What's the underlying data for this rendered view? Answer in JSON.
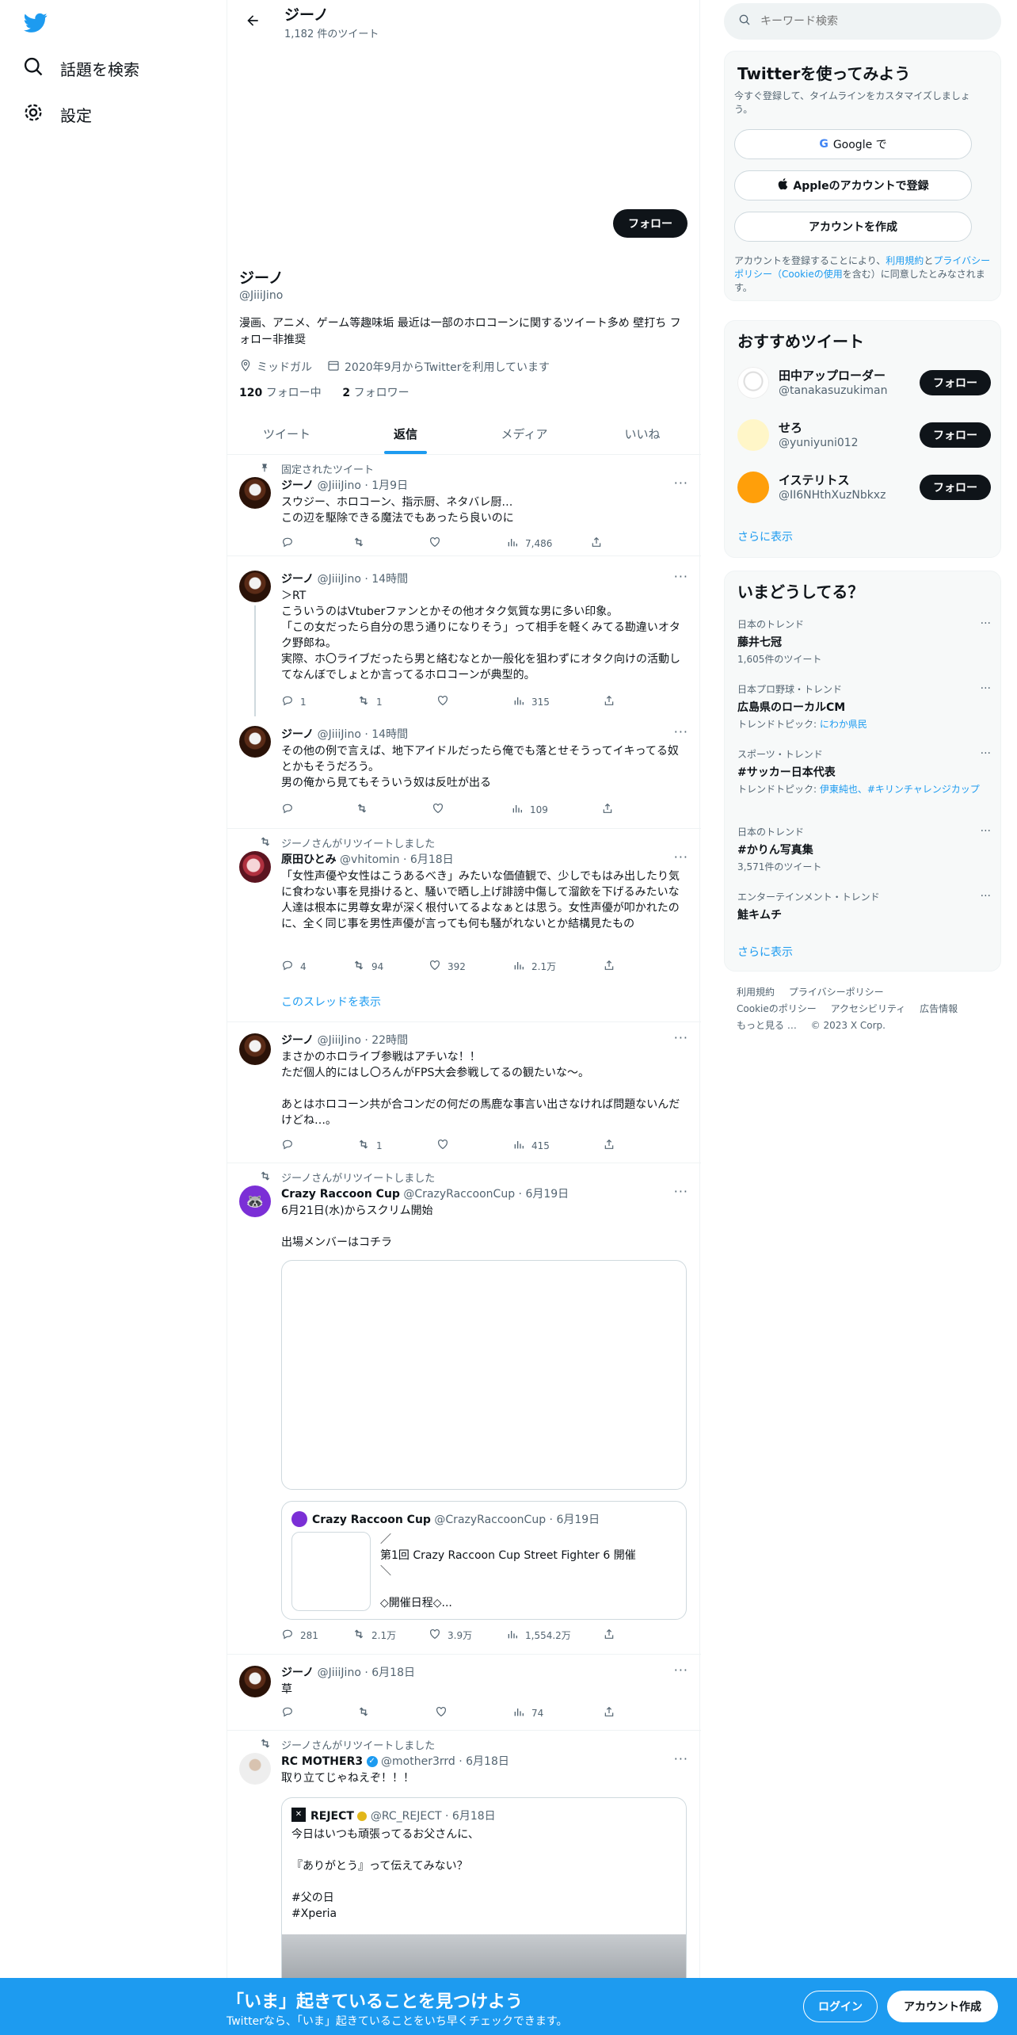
{
  "nav": {
    "explore_label": "話題を検索",
    "settings_label": "設定"
  },
  "header": {
    "name": "ジーノ",
    "tweet_count": "1,182 件のツイート"
  },
  "profile": {
    "follow_label": "フォロー",
    "name": "ジーノ",
    "handle": "@JiiiJino",
    "bio": "漫画、アニメ、ゲーム等趣味垢 最近は一部のホロコーンに関するツイート多め 壁打ち フォロー非推奨",
    "location": "ミッドガル",
    "joined": "2020年9月からTwitterを利用しています",
    "following_count": "120",
    "following_label": "フォロー中",
    "followers_count": "2",
    "followers_label": "フォロワー"
  },
  "tabs": [
    "ツイート",
    "返信",
    "メディア",
    "いいね"
  ],
  "tweets": [
    {
      "context": "固定されたツイート",
      "name": "ジーノ",
      "handle": "@JiiiJino",
      "time": "1月9日",
      "text": "スウジー、ホロコーン、指示厨、ネタバレ厨…\nこの辺を駆除できる魔法でもあったら良いのに",
      "replies": "",
      "retweets": "",
      "likes": "",
      "views": "7,486"
    },
    {
      "name": "ジーノ",
      "handle": "@JiiiJino",
      "time": "14時間",
      "text": "＞RT\nこういうのはVtuberファンとかその他オタク気質な男に多い印象。\n「この女だったら自分の思う通りになりそう」って相手を軽くみてる勘違いオタク野郎ね。\n実際、ホ〇ライブだったら男と絡むなとか一般化を狙わずにオタク向けの活動してなんぼでしょとか言ってるホロコーンが典型的。",
      "replies": "1",
      "retweets": "1",
      "likes": "",
      "views": "315"
    },
    {
      "name": "ジーノ",
      "handle": "@JiiiJino",
      "time": "14時間",
      "text": "その他の例で言えば、地下アイドルだったら俺でも落とせそうってイキってる奴とかもそうだろう。\n男の俺から見てもそういう奴は反吐が出る",
      "replies": "",
      "retweets": "",
      "likes": "",
      "views": "109"
    },
    {
      "context": "ジーノさんがリツイートしました",
      "name": "原田ひとみ",
      "handle": "@vhitomin",
      "time": "6月18日",
      "text": "「女性声優や女性はこうあるべき」みたいな価値観で、少しでもはみ出したり気に食わない事を見掛けると、騒いで晒し上げ誹謗中傷して溜飲を下げるみたいな人達は根本に男尊女卑が深く根付いてるよなぁとは思う。女性声優が叩かれたのに、全く同じ事を男性声優が言っても何も騒がれないとか結構見たもの",
      "replies": "4",
      "retweets": "94",
      "likes": "392",
      "views": "2.1万",
      "show_thread": "このスレッドを表示"
    },
    {
      "name": "ジーノ",
      "handle": "@JiiiJino",
      "time": "22時間",
      "text": "まさかのホロライブ参戦はアチいな！！\nただ個人的にはし〇ろんがFPS大会参戦してるの観たいな〜。\n\nあとはホロコーン共が合コンだの何だの馬鹿な事言い出さなければ問題ないんだけどね…。",
      "replies": "",
      "retweets": "1",
      "likes": "",
      "views": "415"
    },
    {
      "context": "ジーノさんがリツイートしました",
      "name": "Crazy Raccoon Cup",
      "handle": "@CrazyRaccoonCup",
      "time": "6月19日",
      "text": "6月21日(水)からスクリム開始\n\n出場メンバーはコチラ",
      "quote_name": "Crazy Raccoon Cup",
      "quote_handle": "@CrazyRaccoonCup",
      "quote_time": "6月19日",
      "quote_text": "／\n第1回 Crazy Raccoon Cup Street Fighter 6 開催\n＼\n\n◇開催日程◇...",
      "replies": "281",
      "retweets": "2.1万",
      "likes": "3.9万",
      "views": "1,554.2万"
    },
    {
      "name": "ジーノ",
      "handle": "@JiiiJino",
      "time": "6月18日",
      "text": "草",
      "replies": "",
      "retweets": "",
      "likes": "",
      "views": "74"
    },
    {
      "context": "ジーノさんがリツイートしました",
      "name": "RC MOTHER3",
      "handle": "@mother3rrd",
      "time": "6月18日",
      "text": "取り立てじゃねえぞ！！！",
      "quote_name": "REJECT",
      "quote_handle": "@RC_REJECT",
      "quote_time": "6月18日",
      "quote_text": "今日はいつも頑張ってるお父さんに、\n\n『ありがとう』って伝えてみない？\n\n#父の日\n#Xperia"
    }
  ],
  "search": {
    "placeholder": "キーワード検索"
  },
  "signup_card": {
    "title": "Twitterを使ってみよう",
    "subtitle": "今すぐ登録して、タイムラインをカスタマイズしましょう。",
    "google_label": "Google で",
    "apple_label": "Appleのアカウントで登録",
    "create_label": "アカウントを作成",
    "legal_prefix": "アカウントを登録することにより、",
    "legal_terms": "利用規約",
    "legal_and": "と",
    "legal_privacy": "プライバシーポリシー",
    "legal_cookie": "（Cookieの使用",
    "legal_suffix": "を含む）に同意したとみなされます。"
  },
  "recommend": {
    "title": "おすすめツイート",
    "accounts": [
      {
        "name": "田中アップローダー",
        "handle": "@tanakasuzukiman",
        "follow": "フォロー",
        "color": "#ffffff"
      },
      {
        "name": "せろ",
        "handle": "@yuniyuni012",
        "follow": "フォロー",
        "color": "#fff6c8"
      },
      {
        "name": "イステリトス",
        "handle": "@II6NHthXuzNbkxz",
        "follow": "フォロー",
        "color": "#ff9f0a"
      }
    ],
    "more": "さらに表示"
  },
  "trends": {
    "title": "いまどうしてる？",
    "items": [
      {
        "category": "日本のトレンド",
        "name": "藤井七冠",
        "sub": "1,605件のツイート"
      },
      {
        "category": "日本プロ野球・トレンド",
        "name": "広島県のローカルCM",
        "sub_prefix": "トレンドトピック: ",
        "sub_link": "にわか県民"
      },
      {
        "category": "スポーツ・トレンド",
        "name": "#サッカー日本代表",
        "sub_prefix": "トレンドトピック: ",
        "sub_link": "伊東純也、#キリンチャレンジカップ"
      },
      {
        "category": "日本のトレンド",
        "name": "#かりん写真集",
        "sub": "3,571件のツイート"
      },
      {
        "category": "エンターテインメント・トレンド",
        "name": "鮭キムチ"
      }
    ],
    "more": "さらに表示"
  },
  "footer": {
    "links": [
      "利用規約",
      "プライバシーポリシー",
      "Cookieのポリシー",
      "アクセシビリティ",
      "広告情報",
      "もっと見る …"
    ],
    "copyright": "© 2023 X Corp."
  },
  "bottombar": {
    "title": "「いま」起きていることを見つけよう",
    "subtitle": "Twitterなら、「いま」起きていることをいち早くチェックできます。",
    "login": "ログイン",
    "signup": "アカウント作成"
  },
  "colors": {
    "accent": "#1d9bf0",
    "text": "#0f1419",
    "muted": "#536471"
  }
}
